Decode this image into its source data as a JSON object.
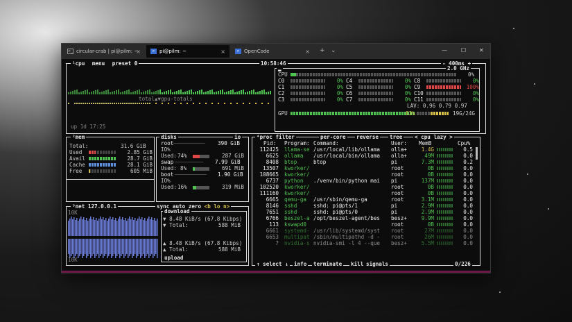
{
  "window": {
    "tabs": [
      {
        "label": "circular-crab | pi@pilm: ~",
        "icon": "terminal-icon"
      },
      {
        "label": "pi@pilm: ~",
        "icon": "powershell-icon"
      },
      {
        "label": "OpenCode",
        "icon": "powershell-icon"
      }
    ],
    "new_tab": "+",
    "dropdown": "⌄",
    "minimize": "—",
    "maximize": "☐",
    "close": "✕",
    "tab_close": "×"
  },
  "cpu": {
    "header_left": "¹cpu",
    "menu": "menu",
    "preset": "preset 0",
    "clock": "10:58:46",
    "interval": "- 400ms +",
    "freq": "2.0 GHz",
    "graph_label": "total▲▼gpu-totals",
    "uptime": "up 1d 17:25",
    "total_label": "CPU",
    "total_pct": "0%",
    "cores": [
      {
        "name": "C0",
        "pct": "0%"
      },
      {
        "name": "C1",
        "pct": "0%"
      },
      {
        "name": "C2",
        "pct": "0%"
      },
      {
        "name": "C3",
        "pct": "0%"
      },
      {
        "name": "C4",
        "pct": "0%"
      },
      {
        "name": "C5",
        "pct": "0%"
      },
      {
        "name": "C6",
        "pct": "0%"
      },
      {
        "name": "C7",
        "pct": "0%"
      },
      {
        "name": "C8",
        "pct": "0%"
      },
      {
        "name": "C9",
        "pct": "100%"
      },
      {
        "name": "C10",
        "pct": "0%"
      },
      {
        "name": "C11",
        "pct": "0%"
      }
    ],
    "lav": "LAV: 0.96 0.79 0.97",
    "gpu_label": "GPU",
    "gpu_pct": "83%",
    "gpu_mem": "19G/24G"
  },
  "mem": {
    "header": "²mem",
    "total_label": "Total:",
    "total": "31.6 GiB",
    "rows": [
      {
        "label": "Used",
        "value": "2.85 GiB"
      },
      {
        "label": "Avail",
        "value": "28.7 GiB"
      },
      {
        "label": "Cache",
        "value": "28.1 GiB"
      },
      {
        "label": "Free",
        "value": "605 MiB"
      }
    ]
  },
  "disks": {
    "header": "disks",
    "io_tag": "io",
    "root_name": "root",
    "root_size": "390 GiB",
    "root_io": "IO%",
    "root_used_label": "Used:",
    "root_used_pct": "74%",
    "root_used": "287 GiB",
    "swap_name": "swap",
    "swap_size": "7.99 GiB",
    "swap_used_label": "Used:",
    "swap_used_pct": "8%",
    "swap_used": "691 MiB",
    "boot_name": "boot",
    "boot_size": "1.90 GiB",
    "boot_io": "IO%",
    "boot_used_label": "Used:",
    "boot_used_pct": "16%",
    "boot_used": "319 MiB"
  },
  "net": {
    "header": "³net",
    "iface": "127.0.0.1",
    "sync": "sync",
    "auto": "auto",
    "zero": "zero",
    "nav": "<b lo n>",
    "scale_top": "10K",
    "scale_bot": "10K",
    "download": "download",
    "down_rate": "▼ 8.48 KiB/s (67.8 Kibps)",
    "down_total_label": "▼ Total:",
    "down_total": "588 MiB",
    "up_rate": "▲ 8.48 KiB/s (67.8 Kibps)",
    "up_total_label": "▲ Total:",
    "up_total": "588 MiB",
    "upload": "upload"
  },
  "proc": {
    "header": "⁴proc",
    "filter": "filter",
    "per_core": "per-core",
    "reverse": "reverse",
    "tree": "tree",
    "sort": "cpu lazy",
    "cols": {
      "pid": "Pid:",
      "program": "Program:",
      "command": "Command:",
      "user": "User:",
      "mem": "MemB",
      "cpu": "Cpu%"
    },
    "rows": [
      {
        "pid": "112425",
        "program": "llama-se",
        "command": "/usr/local/lib/ollama",
        "user": "olla+",
        "mem": "1.4G",
        "cpu": "0.5"
      },
      {
        "pid": "6625",
        "program": "ollama",
        "command": "/usr/local/bin/ollama",
        "user": "olla+",
        "mem": "49M",
        "cpu": "0.0"
      },
      {
        "pid": "8408",
        "program": "btop",
        "command": "btop",
        "user": "pi",
        "mem": "7.3M",
        "cpu": "0.2"
      },
      {
        "pid": "13507",
        "program": "kworker/",
        "command": "",
        "user": "root",
        "mem": "0B",
        "cpu": "0.0"
      },
      {
        "pid": "108665",
        "program": "kworker/",
        "command": "",
        "user": "root",
        "mem": "0B",
        "cpu": "0.0"
      },
      {
        "pid": "6737",
        "program": "python",
        "command": "./venv/bin/python mai",
        "user": "pi",
        "mem": "137M",
        "cpu": "0.0"
      },
      {
        "pid": "102520",
        "program": "kworker/",
        "command": "",
        "user": "root",
        "mem": "0B",
        "cpu": "0.0"
      },
      {
        "pid": "111160",
        "program": "kworker/",
        "command": "",
        "user": "root",
        "mem": "0B",
        "cpu": "0.0"
      },
      {
        "pid": "6665",
        "program": "qemu-ga",
        "command": "/usr/sbin/qemu-ga",
        "user": "root",
        "mem": "3.1M",
        "cpu": "0.0"
      },
      {
        "pid": "8146",
        "program": "sshd",
        "command": "sshd: pi@pts/1",
        "user": "pi",
        "mem": "2.9M",
        "cpu": "0.0"
      },
      {
        "pid": "7651",
        "program": "sshd",
        "command": "sshd: pi@pts/0",
        "user": "pi",
        "mem": "2.9M",
        "cpu": "0.0"
      },
      {
        "pid": "6766",
        "program": "beszel-a",
        "command": "/opt/beszel-agent/bes",
        "user": "besz+",
        "mem": "9.9M",
        "cpu": "0.0"
      },
      {
        "pid": "113",
        "program": "kswapd0",
        "command": "",
        "user": "root",
        "mem": "0B",
        "cpu": "0.0"
      },
      {
        "pid": "6661",
        "program": "systemd-",
        "command": "/usr/lib/systemd/syst",
        "user": "root",
        "mem": "27M",
        "cpu": "0.0"
      },
      {
        "pid": "6653",
        "program": "multipat",
        "command": "/sbin/multipathd -d -",
        "user": "root",
        "mem": "26M",
        "cpu": "0.0"
      },
      {
        "pid": "7",
        "program": "nvidia-s",
        "command": "nvidia-smi -l 4 --que",
        "user": "besz+",
        "mem": "5.5M",
        "cpu": "0.0"
      }
    ],
    "footer": {
      "select": "↑ select ↓",
      "info": "info",
      "terminate": "terminate",
      "kill": "kill",
      "signals": "signals",
      "count": "0/226"
    }
  },
  "colors": {
    "accent": "#6b1848",
    "green": "#4fc34f",
    "red": "#e04848",
    "yellow": "#d8c14a"
  }
}
